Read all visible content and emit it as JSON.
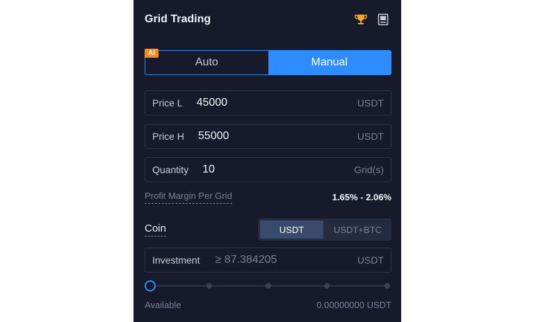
{
  "header": {
    "title": "Grid Trading",
    "trophy_icon": "trophy-icon",
    "guide_icon": "book-icon",
    "trophy_color": "#f5a623"
  },
  "mode_tabs": {
    "badge": "AI",
    "auto_label": "Auto",
    "manual_label": "Manual",
    "active": "Manual",
    "accent": "#2f8cff"
  },
  "fields": {
    "price_low": {
      "label": "Price L",
      "value": "45000",
      "unit": "USDT"
    },
    "price_high": {
      "label": "Price H",
      "value": "55000",
      "unit": "USDT"
    },
    "quantity": {
      "label": "Quantity",
      "value": "10",
      "unit": "Grid(s)"
    }
  },
  "profit_margin": {
    "label": "Profit Margin Per Grid",
    "value": "1.65% - 2.06%"
  },
  "coin": {
    "label": "Coin",
    "options": [
      "USDT",
      "USDT+BTC"
    ],
    "selected": "USDT"
  },
  "investment": {
    "label": "Investment",
    "placeholder": "≥ 87.384205",
    "unit": "USDT"
  },
  "slider": {
    "value_percent": 0,
    "stops": 5
  },
  "available": {
    "label": "Available",
    "value": "0.00000000 USDT"
  }
}
